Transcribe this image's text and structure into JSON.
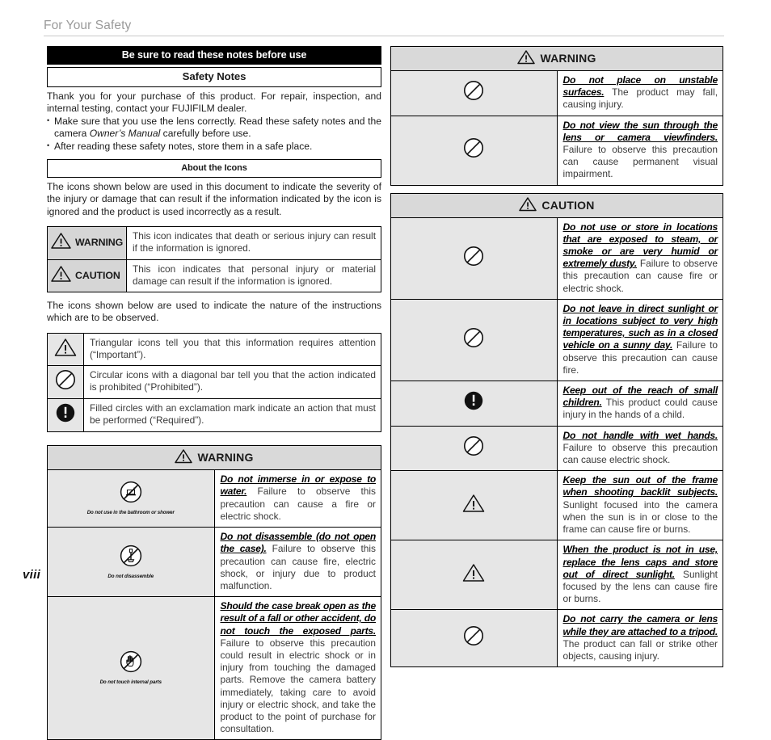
{
  "page": {
    "running_head": "For Your Safety",
    "folio": "viii"
  },
  "left": {
    "banner_black": "Be sure to read these notes before use",
    "banner_safety_notes": "Safety Notes",
    "intro_paragraph": "Thank you for your purchase of this product.  For repair, inspection, and internal testing, contact your FUJIFILM dealer.",
    "bullets": [
      {
        "pre": "Make sure that you use the lens correctly.  Read these safety notes and the camera ",
        "italic": "Owner’s Manual",
        "post": " carefully before use."
      },
      {
        "pre": "After reading these safety notes, store them in a safe place.",
        "italic": "",
        "post": ""
      }
    ],
    "banner_about_icons": "About the Icons",
    "about_icons_paragraph": "The icons shown below are used in this document to indicate the severity of the injury or damage that can result if the information indicated by the icon is ignored and the product is used incorrectly as a result.",
    "severity_table": [
      {
        "icon": "warning-triangle-icon",
        "label": "WARNING",
        "text": "This icon indicates that death or serious injury can result if the information is ignored."
      },
      {
        "icon": "warning-triangle-icon",
        "label": "CAUTION",
        "text": "This icon indicates that personal injury or material damage can result if the information is ignored."
      }
    ],
    "nature_paragraph": "The icons shown below are used to indicate the nature of the instructions which are to be observed.",
    "shape_table": [
      {
        "icon": "triangle-attention-icon",
        "text": "Triangular icons tell you that this information requires attention (“Important”)."
      },
      {
        "icon": "prohibited-circle-icon",
        "text": "Circular icons with a diagonal bar tell you that the action indicated is prohibited (“Prohibited”)."
      },
      {
        "icon": "required-filled-circle-icon",
        "text": "Filled circles with an exclamation mark indicate an action that must be performed (“Required”)."
      }
    ],
    "warning_header": "WARNING",
    "warning_rows": [
      {
        "icon": "no-bathroom-use-icon",
        "caption": "Do not use in the bathroom or shower",
        "bold": "Do not immerse in or expose to water.",
        "text": " Failure to observe this precaution can cause a fire or electric shock."
      },
      {
        "icon": "no-disassemble-icon",
        "caption": "Do not disassemble",
        "bold": "Do not disassemble (do not open the case).",
        "text": " Failure to observe this precaution can cause fire, electric shock, or injury due to product malfunction."
      },
      {
        "icon": "do-not-touch-internal-parts-icon",
        "caption": "Do not touch internal parts",
        "bold": "Should the case break open as the result of a fall or other accident, do not touch the exposed parts.",
        "text": " Failure to observe this precaution could result in electric shock or in injury from touching the damaged parts.  Remove the camera battery immediately, taking care to avoid injury or electric shock, and take the product to the point of purchase for consultation."
      }
    ]
  },
  "right": {
    "warning_header": "WARNING",
    "warning_rows": [
      {
        "icon": "prohibited-circle-icon",
        "bold": "Do not place on unstable surfaces.",
        "text": " The product may fall, causing injury."
      },
      {
        "icon": "prohibited-circle-icon",
        "bold": "Do not view the sun through the lens or camera viewfinders.",
        "text": " Failure to observe this precaution can cause permanent visual impairment."
      }
    ],
    "caution_header": "CAUTION",
    "caution_rows": [
      {
        "icon": "prohibited-circle-icon",
        "bold": "Do not use or store in locations that are exposed to steam, or smoke or are very humid or extremely dusty.",
        "text": " Failure to observe this precaution can cause fire or electric shock."
      },
      {
        "icon": "prohibited-circle-icon",
        "bold": "Do not leave in direct sunlight or in locations subject to very high temperatures, such as in a closed vehicle on a sunny day.",
        "text": " Failure to observe this precaution can cause fire."
      },
      {
        "icon": "required-filled-circle-icon",
        "bold": "Keep out of the reach of small children.",
        "text": " This product could cause injury in the hands of a child."
      },
      {
        "icon": "prohibited-circle-icon",
        "bold": "Do not handle with wet hands.",
        "text": " Failure to observe this precaution can cause electric shock."
      },
      {
        "icon": "triangle-attention-icon",
        "bold": "Keep the sun out of the frame when shooting backlit subjects.",
        "text": " Sunlight focused into the camera when the sun is in or close to the frame can cause fire or burns."
      },
      {
        "icon": "triangle-attention-icon",
        "bold": "When the product is not in use, replace the lens caps and store out of direct sunlight.",
        "text": " Sunlight focused by the lens can cause fire or burns."
      },
      {
        "icon": "prohibited-circle-icon",
        "bold": "Do not carry the camera or lens while they are attached to a tripod.",
        "text": " The product can fall or strike other objects, causing injury."
      }
    ]
  },
  "colors": {
    "banner_black_bg": "#000000",
    "header_row_bg": "#d9d9d9",
    "icon_cell_bg": "#e6e6e6",
    "body_text": "#3a3a3a",
    "running_head": "#9a9a9a"
  }
}
